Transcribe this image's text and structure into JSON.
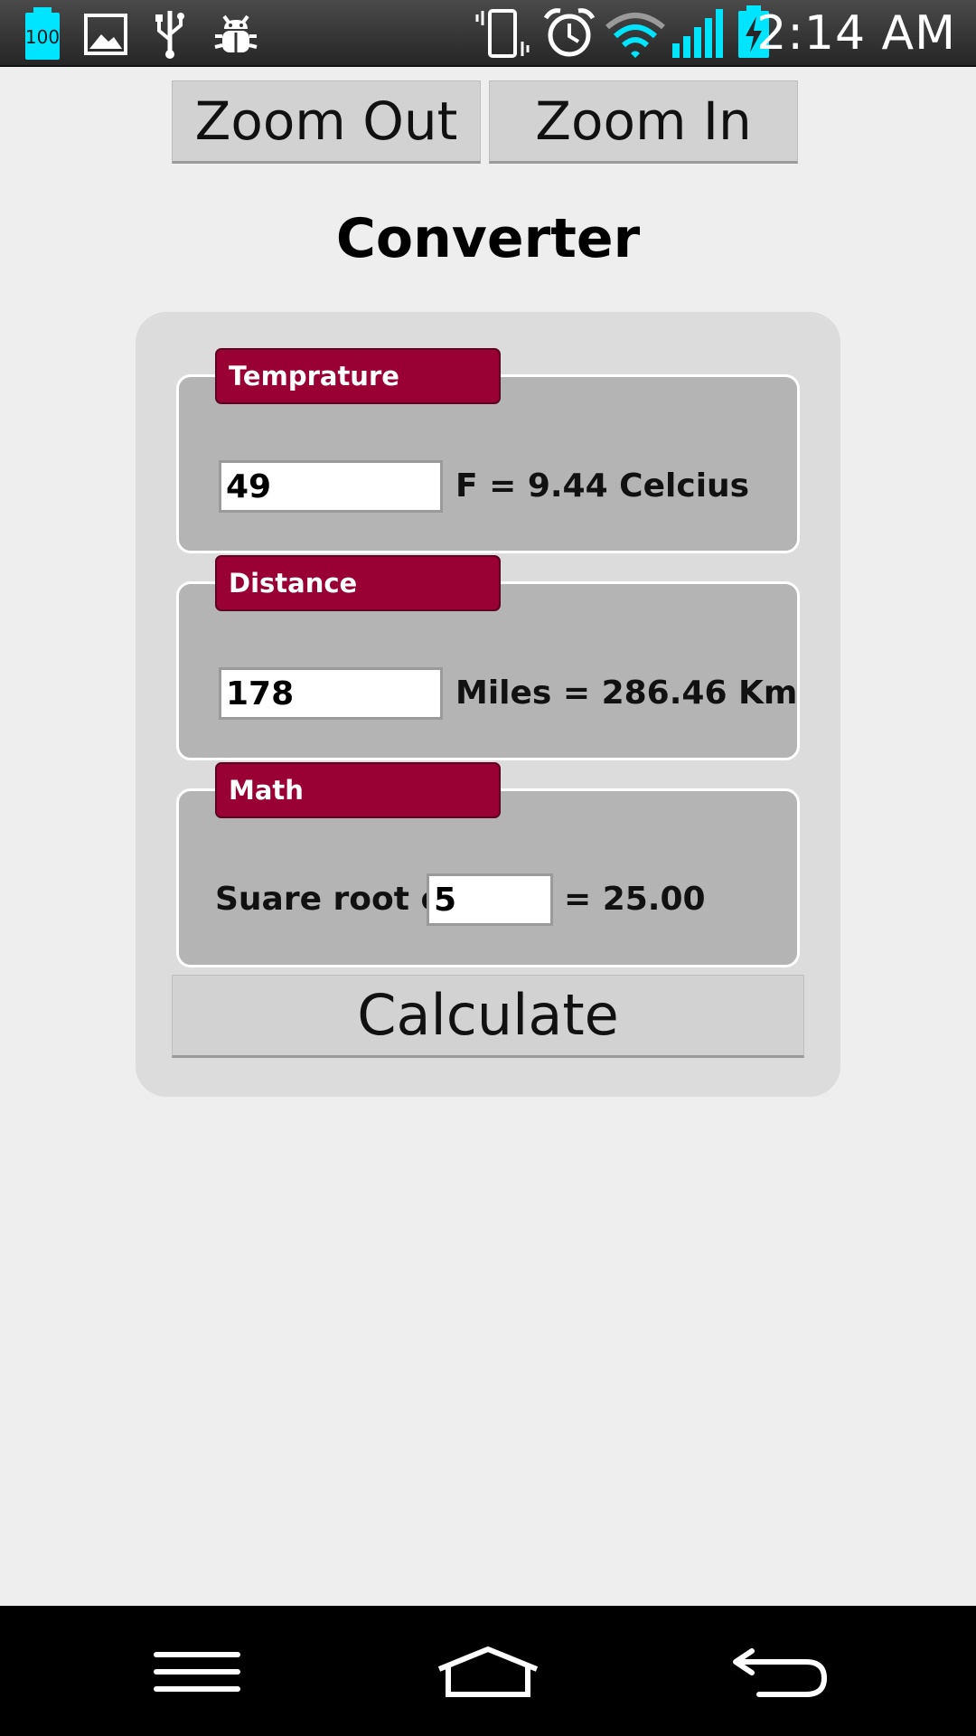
{
  "status_bar": {
    "battery_badge": "100",
    "time": "2:14 AM",
    "icons": [
      "battery-100-icon",
      "gallery-icon",
      "usb-icon",
      "debug-bug-icon",
      "vibrate-icon",
      "alarm-icon",
      "wifi-icon",
      "signal-icon",
      "battery-charging-icon"
    ],
    "accent_color": "#00e5ff"
  },
  "toolbar": {
    "zoom_out_label": "Zoom Out",
    "zoom_in_label": "Zoom In"
  },
  "page": {
    "title": "Converter"
  },
  "sections": {
    "temperature": {
      "legend": "Temprature",
      "input_value": "49",
      "result": "F = 9.44 Celcius"
    },
    "distance": {
      "legend": "Distance",
      "input_value": "178",
      "result": "Miles = 286.46 Km"
    },
    "math": {
      "legend": "Math",
      "label": "Suare root of",
      "input_value": "5",
      "result": "= 25.00"
    }
  },
  "actions": {
    "calculate_label": "Calculate"
  },
  "nav_bar": {
    "icons": [
      "menu-icon",
      "home-icon",
      "back-icon"
    ]
  },
  "colors": {
    "legend_bg": "#990033",
    "fieldset_bg": "#b4b4b4",
    "panel_bg": "#dcdcdc",
    "button_bg": "#d2d2d2"
  }
}
